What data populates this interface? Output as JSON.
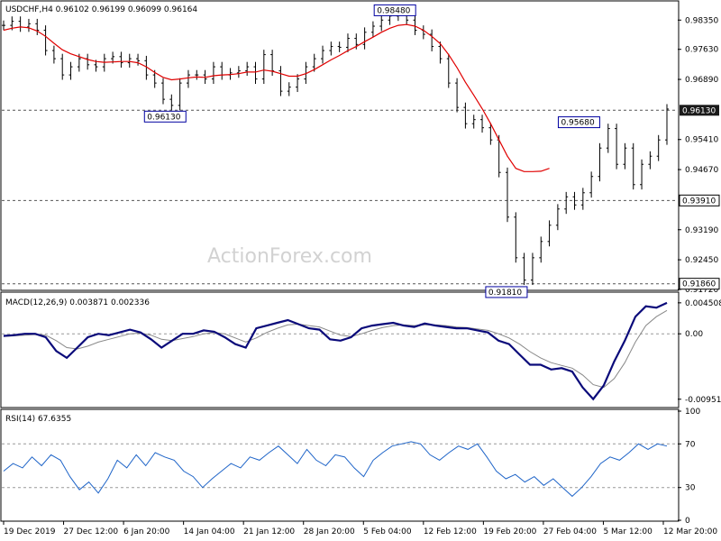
{
  "header": {
    "main": "USDCHF,H4  0.96102 0.96199 0.96099 0.96164",
    "macd": "MACD(12,26,9) 0.003871 0.002336",
    "rsi": "RSI(14) 67.6355"
  },
  "watermark": "ActionForex.com",
  "colors": {
    "price": "#000000",
    "ma": "#e00000",
    "macd": "#0a0a7a",
    "signal": "#888888",
    "rsi": "#1e64c8",
    "current_box": "#1a1a1a",
    "label_box": "#ffffff",
    "label_border": "#0000a0"
  },
  "chart_data": [
    {
      "type": "line",
      "name": "USDCHF H4 price",
      "ylim": [
        0.9172,
        0.988
      ],
      "y_ticks": [
        "0.98350",
        "0.97630",
        "0.96890",
        "0.95410",
        "0.94670",
        "0.93190",
        "0.92450",
        "0.91720"
      ],
      "x": [
        0,
        4,
        8,
        12,
        16,
        20,
        24,
        28,
        32,
        36,
        40,
        44,
        48,
        52,
        56,
        60,
        64,
        68,
        72,
        76,
        80,
        84,
        88,
        92,
        96,
        100,
        104,
        108,
        112,
        116,
        120,
        124,
        128,
        132,
        136,
        140,
        144,
        148,
        152,
        156,
        160,
        164,
        168,
        172,
        176,
        180,
        184,
        188,
        192,
        196,
        200,
        204,
        208,
        212,
        216,
        220,
        224,
        228,
        232
      ],
      "values": [
        0.9822,
        0.9832,
        0.9818,
        0.9826,
        0.981,
        0.976,
        0.974,
        0.97,
        0.972,
        0.974,
        0.9725,
        0.972,
        0.974,
        0.9745,
        0.973,
        0.974,
        0.9735,
        0.97,
        0.968,
        0.964,
        0.9625,
        0.968,
        0.97,
        0.97,
        0.969,
        0.972,
        0.97,
        0.9705,
        0.971,
        0.972,
        0.969,
        0.975,
        0.971,
        0.966,
        0.967,
        0.969,
        0.972,
        0.974,
        0.976,
        0.977,
        0.9768,
        0.979,
        0.9775,
        0.9805,
        0.982,
        0.9835,
        0.9845,
        0.9848,
        0.9835,
        0.981,
        0.98,
        0.977,
        0.974,
        0.968,
        0.962,
        0.958,
        0.959,
        0.957,
        0.954
      ],
      "values_tail": [
        0.946,
        0.935,
        0.925,
        0.9195,
        0.925,
        0.929,
        0.933,
        0.937,
        0.94,
        0.938,
        0.941,
        0.945,
        0.952,
        0.9568,
        0.948,
        0.952,
        0.943,
        0.948,
        0.95,
        0.954,
        0.9616
      ],
      "ma_values": [
        0.981,
        0.9815,
        0.9818,
        0.9816,
        0.9808,
        0.9795,
        0.9778,
        0.9762,
        0.9752,
        0.9745,
        0.9738,
        0.9733,
        0.9731,
        0.9732,
        0.9733,
        0.9733,
        0.973,
        0.972,
        0.9706,
        0.9694,
        0.9688,
        0.969,
        0.9693,
        0.9695,
        0.9694,
        0.9698,
        0.97,
        0.9701,
        0.9703,
        0.9707,
        0.9707,
        0.9712,
        0.9709,
        0.9703,
        0.9697,
        0.9697,
        0.9703,
        0.9713,
        0.9725,
        0.9737,
        0.9748,
        0.976,
        0.977,
        0.9782,
        0.9793,
        0.9805,
        0.9815,
        0.9822,
        0.9824,
        0.982,
        0.981,
        0.9795,
        0.9777,
        0.975,
        0.9718,
        0.9682,
        0.965,
        0.9617,
        0.958
      ],
      "ma_tail": [
        0.954,
        0.95,
        0.947,
        0.9462,
        0.9462,
        0.9463,
        0.947
      ],
      "levels": [
        {
          "value": 0.9848,
          "label": "0.98480"
        },
        {
          "value": 0.9613,
          "label": "0.96130"
        },
        {
          "value": 0.9568,
          "label": "0.95680"
        },
        {
          "value": 0.9391,
          "label": "0.93910"
        },
        {
          "value": 0.9181,
          "label": "0.91810"
        },
        {
          "value": 0.9186,
          "label": "0.91860"
        }
      ],
      "current": {
        "value": 0.9613,
        "label": "0.96130"
      }
    },
    {
      "type": "line",
      "name": "MACD(12,26,9)",
      "ylim": [
        -0.0106,
        0.0058
      ],
      "y_ticks": [
        "0.004508",
        "0.00",
        "-0.009518"
      ],
      "macd": [
        -0.0003,
        -0.0002,
        0.0,
        0.0,
        -0.0005,
        -0.0025,
        -0.0035,
        -0.002,
        -0.0005,
        0.0,
        -0.0002,
        0.0002,
        0.0006,
        0.0002,
        -0.0008,
        -0.002,
        -0.001,
        0.0,
        0.0,
        0.0005,
        0.0003,
        -0.0005,
        -0.0015,
        -0.002,
        0.0008,
        0.0012,
        0.0016,
        0.002,
        0.0014,
        0.0008,
        0.0006,
        -0.0008,
        -0.001,
        -0.0005,
        0.0008,
        0.0012,
        0.0014,
        0.0016,
        0.0012,
        0.001,
        0.0015,
        0.0012,
        0.001,
        0.0008,
        0.0008,
        0.0005,
        0.0002,
        -0.001,
        -0.0015,
        -0.003,
        -0.0045,
        -0.0045,
        -0.0052,
        -0.005,
        -0.0055,
        -0.0078,
        -0.0095,
        -0.0075,
        -0.004,
        -0.001,
        0.0025,
        0.004,
        0.0038,
        0.0045
      ],
      "signal": [
        -0.0004,
        -0.0003,
        -0.0002,
        -0.0001,
        -0.0002,
        -0.001,
        -0.002,
        -0.0022,
        -0.0018,
        -0.0012,
        -0.0008,
        -0.0004,
        0.0,
        0.0001,
        -0.0002,
        -0.0008,
        -0.001,
        -0.0007,
        -0.0004,
        0.0,
        0.0002,
        0.0,
        -0.0006,
        -0.0012,
        -0.0006,
        0.0002,
        0.0008,
        0.0013,
        0.0014,
        0.0012,
        0.001,
        0.0004,
        -0.0002,
        -0.0004,
        0.0,
        0.0005,
        0.0009,
        0.0012,
        0.0013,
        0.0012,
        0.0013,
        0.0013,
        0.0012,
        0.001,
        0.0009,
        0.0007,
        0.0005,
        0.0,
        -0.0006,
        -0.0015,
        -0.0026,
        -0.0035,
        -0.0042,
        -0.0046,
        -0.005,
        -0.006,
        -0.0074,
        -0.0078,
        -0.0065,
        -0.0042,
        -0.0012,
        0.0012,
        0.0025,
        0.0034
      ]
    },
    {
      "type": "line",
      "name": "RSI(14)",
      "ylim": [
        0,
        100
      ],
      "y_ticks": [
        "100",
        "70",
        "30",
        "0"
      ],
      "levels": [
        70,
        30
      ],
      "values": [
        45,
        52,
        48,
        58,
        50,
        60,
        55,
        40,
        28,
        35,
        25,
        38,
        55,
        48,
        60,
        50,
        62,
        58,
        55,
        45,
        40,
        30,
        38,
        45,
        52,
        48,
        58,
        55,
        62,
        68,
        60,
        52,
        65,
        55,
        50,
        60,
        58,
        48,
        40,
        55,
        62,
        68,
        70,
        72,
        70,
        60,
        55,
        62,
        68,
        65,
        70,
        58,
        45,
        38,
        42,
        35,
        40,
        32,
        38,
        30,
        22,
        30,
        40,
        52,
        58,
        55,
        62,
        70,
        65,
        70,
        68
      ]
    }
  ],
  "x_axis": {
    "labels": [
      "19 Dec 2019",
      "27 Dec 12:00",
      "6 Jan 20:00",
      "14 Jan 04:00",
      "21 Jan 12:00",
      "28 Jan 20:00",
      "5 Feb 04:00",
      "12 Feb 12:00",
      "19 Feb 20:00",
      "27 Feb 04:00",
      "5 Mar 12:00",
      "12 Mar 20:00"
    ]
  }
}
